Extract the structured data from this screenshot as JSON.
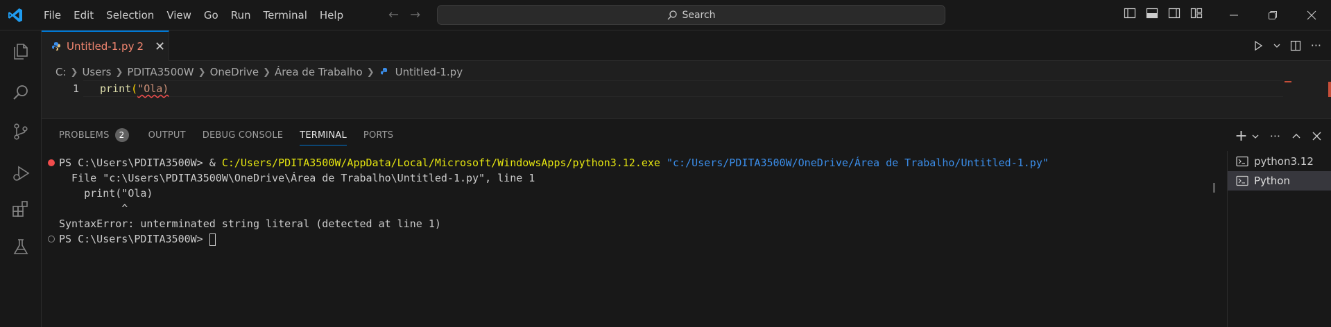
{
  "menu": [
    "File",
    "Edit",
    "Selection",
    "View",
    "Go",
    "Run",
    "Terminal",
    "Help"
  ],
  "search": {
    "label": "Search"
  },
  "activity_icons": [
    "explorer-icon",
    "search-icon",
    "source-control-icon",
    "run-debug-icon",
    "extensions-icon",
    "testing-icon"
  ],
  "editor": {
    "tab": {
      "label": "Untitled-1.py",
      "problems": "2"
    },
    "breadcrumb": [
      "C:",
      "Users",
      "PDITA3500W",
      "OneDrive",
      "Área de Trabalho",
      "Untitled-1.py"
    ],
    "line_number": "1",
    "code": {
      "fn": "print",
      "open": "(",
      "str": "\"Ola)"
    }
  },
  "panel": {
    "tabs": [
      {
        "label": "PROBLEMS",
        "badge": "2"
      },
      {
        "label": "OUTPUT"
      },
      {
        "label": "DEBUG CONSOLE"
      },
      {
        "label": "TERMINAL"
      },
      {
        "label": "PORTS"
      }
    ],
    "terminal": {
      "line1_prompt": "PS C:\\Users\\PDITA3500W> & ",
      "line1_exe": "C:/Users/PDITA3500W/AppData/Local/Microsoft/WindowsApps/python3.12.exe",
      "line1_arg": "\"c:/Users/PDITA3500W/OneDrive/Área de Trabalho/Untitled-1.py\"",
      "line2": "  File \"c:\\Users\\PDITA3500W\\OneDrive\\Área de Trabalho\\Untitled-1.py\", line 1",
      "line3": "    print(\"Ola)",
      "line4": "          ^",
      "line5": "SyntaxError: unterminated string literal (detected at line 1)",
      "line6_prompt": "PS C:\\Users\\PDITA3500W> "
    },
    "terminal_list": [
      "python3.12",
      "Python"
    ]
  },
  "colors": {
    "accent": "#0078d4",
    "error": "#f14c4c",
    "background": "#181818",
    "editor_bg": "#1f1f1f"
  }
}
